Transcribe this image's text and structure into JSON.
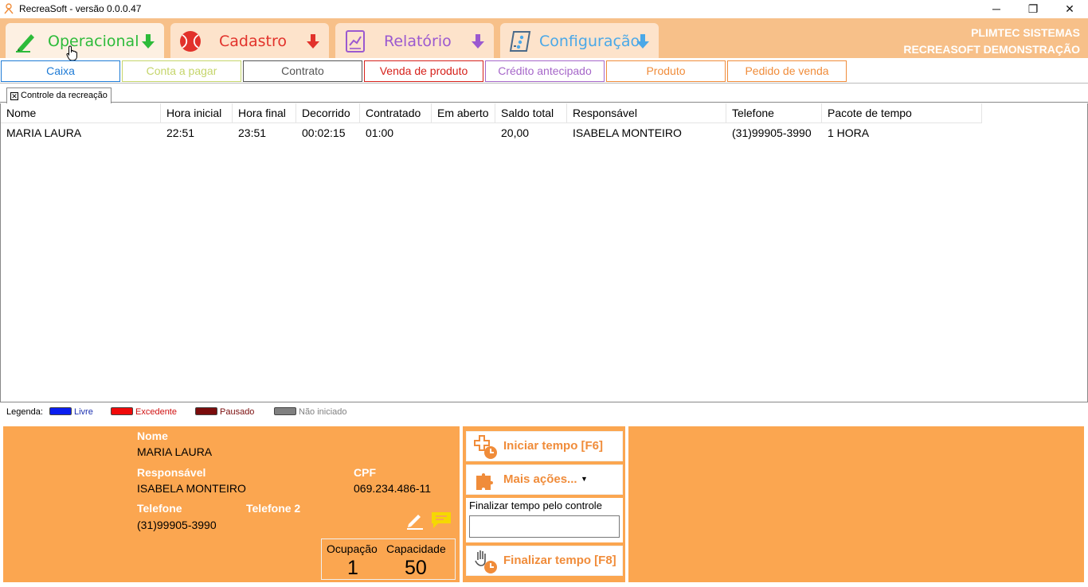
{
  "window": {
    "title": "RecreaSoft  -  versão 0.0.0.47",
    "minimize": "─",
    "maximize": "❐",
    "close": "✕"
  },
  "main_tabs": [
    {
      "label": "Operacional",
      "color": "#2dbb3a",
      "icon": "highlighter-icon"
    },
    {
      "label": "Cadastro",
      "color": "#e2322b",
      "icon": "tennis-ball-icon"
    },
    {
      "label": "Relatório",
      "color": "#9b59d0",
      "icon": "chart-report-icon"
    },
    {
      "label": "Configuração",
      "color": "#4aa8e8",
      "icon": "settings-panel-icon"
    }
  ],
  "company": {
    "line1": "PLIMTEC SISTEMAS",
    "line2": "RECREASOFT DEMONSTRAÇÃO"
  },
  "sub_tabs": [
    {
      "label": "Caixa",
      "color": "#1e7bd6"
    },
    {
      "label": "Conta a pagar",
      "color": "#c5d56b"
    },
    {
      "label": "Contrato",
      "color": "#555555"
    },
    {
      "label": "Venda de produto",
      "color": "#d6211b"
    },
    {
      "label": "Crédito antecipado",
      "color": "#a667c9"
    },
    {
      "label": "Produto",
      "color": "#f08c3a"
    },
    {
      "label": "Pedido de venda",
      "color": "#f08c3a"
    }
  ],
  "doc_tab": {
    "label": "Controle da recreação",
    "close": "✕"
  },
  "grid": {
    "columns": [
      "Nome",
      "Hora inicial",
      "Hora final",
      "Decorrido",
      "Contratado",
      "Em aberto",
      "Saldo total",
      "Responsável",
      "Telefone",
      "Pacote de tempo"
    ],
    "rows": [
      [
        "MARIA LAURA",
        "22:51",
        "23:51",
        "00:02:15",
        "01:00",
        "",
        "20,00",
        "ISABELA MONTEIRO",
        "(31)99905-3990",
        "1 HORA"
      ]
    ]
  },
  "legend": {
    "title": "Legenda:",
    "items": [
      {
        "label": "Livre",
        "color": "#0a1ef0",
        "text_color": "#1a2fb0"
      },
      {
        "label": "Excedente",
        "color": "#f00a0a",
        "text_color": "#d01010"
      },
      {
        "label": "Pausado",
        "color": "#7a0c0c",
        "text_color": "#7a0c0c"
      },
      {
        "label": "Não iniciado",
        "color": "#808080",
        "text_color": "#808080"
      }
    ]
  },
  "info": {
    "nome_label": "Nome",
    "nome": "MARIA LAURA",
    "responsavel_label": "Responsável",
    "responsavel": "ISABELA MONTEIRO",
    "cpf_label": "CPF",
    "cpf": "069.234.486-11",
    "telefone_label": "Telefone",
    "telefone": "(31)99905-3990",
    "telefone2_label": "Telefone 2",
    "telefone2": "",
    "ocupacao_label": "Ocupação",
    "ocupacao": "1",
    "capacidade_label": "Capacidade",
    "capacidade": "50"
  },
  "actions": {
    "iniciar": "Iniciar tempo [F6]",
    "mais": "Mais ações...",
    "finalizar_controle_label": "Finalizar tempo pelo controle",
    "finalizar_controle_value": "",
    "finalizar": "Finalizar tempo [F8]"
  }
}
